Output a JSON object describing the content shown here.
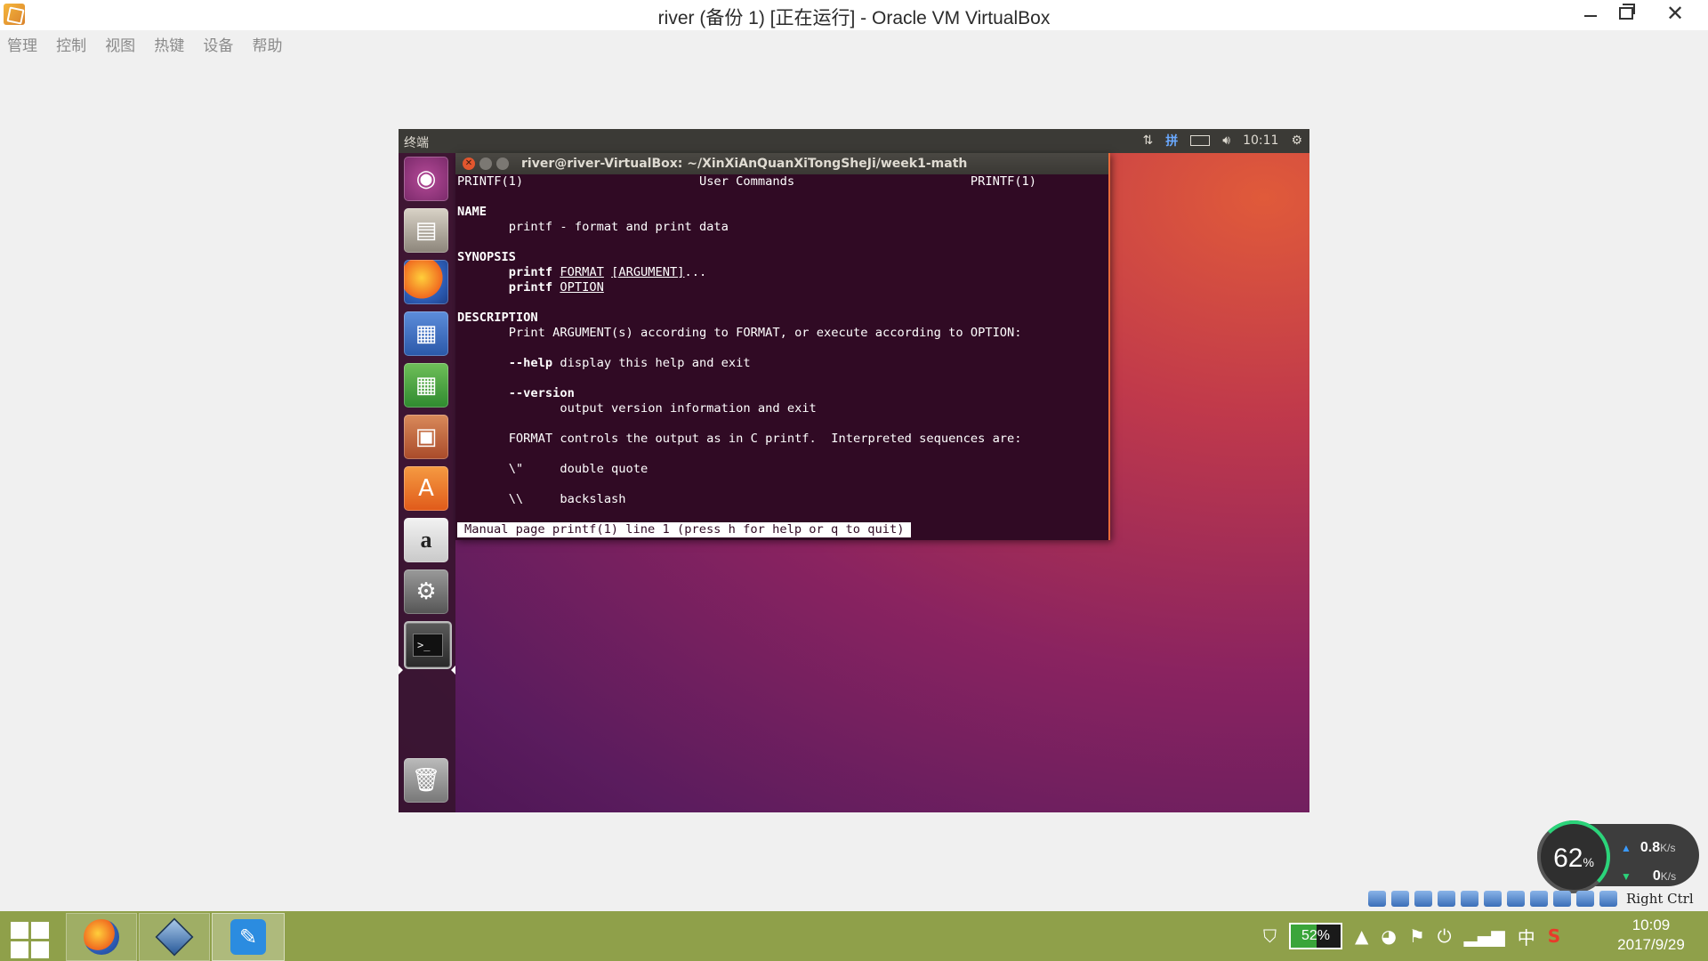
{
  "window": {
    "title": "river (备份 1) [正在运行] - Oracle VM VirtualBox",
    "minimize": "minimize",
    "maximize": "restore",
    "close": "✕"
  },
  "menu": [
    "管理",
    "控制",
    "视图",
    "热键",
    "设备",
    "帮助"
  ],
  "guest": {
    "topbar_title": "终端",
    "clock": "10:11",
    "tray_icons": [
      "network-updown-icon",
      "keyboard-icon",
      "battery-icon",
      "volume-icon",
      "gear-icon"
    ]
  },
  "launcher": [
    "dash-icon",
    "files-icon",
    "firefox-icon",
    "writer-icon",
    "calc-icon",
    "impress-icon",
    "software-center-icon",
    "amazon-icon",
    "system-settings-icon",
    "terminal-icon",
    "trash-icon"
  ],
  "terminal": {
    "title": "river@river-VirtualBox: ~/XinXiAnQuanXiTongSheJi/week1-math",
    "header_left": "PRINTF(1)",
    "header_center": "User Commands",
    "header_right": "PRINTF(1)",
    "name_heading": "NAME",
    "name_text": "printf - format and print data",
    "synopsis_heading": "SYNOPSIS",
    "cmd": "printf",
    "format_arg": "FORMAT",
    "argument_arg": "[ARGUMENT]",
    "ellipsis": "...",
    "option_arg": "OPTION",
    "description_heading": "DESCRIPTION",
    "description_text": "Print ARGUMENT(s) according to FORMAT, or execute according to OPTION:",
    "help_flag": "--help",
    "help_text": "display this help and exit",
    "version_flag": "--version",
    "version_text": "output version information and exit",
    "format_text": "FORMAT controls the output as in C printf.  Interpreted sequences are:",
    "seq1": "\\\"",
    "seq1_desc": "double quote",
    "seq2": "\\\\",
    "seq2_desc": "backslash",
    "status_line": "Manual page printf(1) line 1 (press h for help or q to quit)"
  },
  "statusbar": {
    "host_key": "Right Ctrl"
  },
  "net_widget": {
    "cpu": "62",
    "cpu_unit": "%",
    "up": "0.8",
    "down": "0",
    "unit": "K/s"
  },
  "taskbar": {
    "battery": "52%",
    "ime": "中",
    "time": "10:09",
    "date": "2017/9/29"
  }
}
